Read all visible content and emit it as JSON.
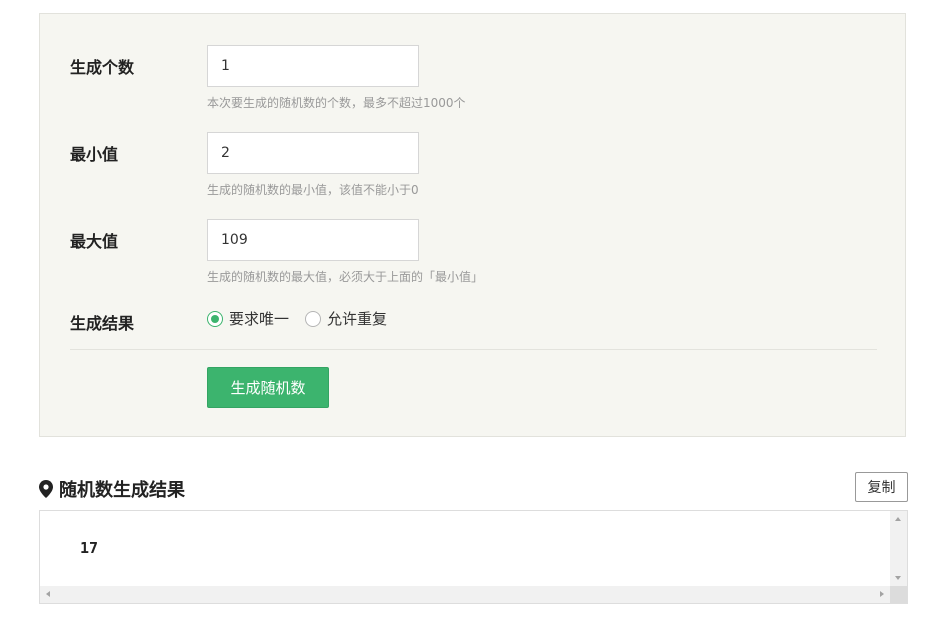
{
  "form": {
    "count": {
      "label": "生成个数",
      "value": "1",
      "hint": "本次要生成的随机数的个数，最多不超过1000个"
    },
    "min": {
      "label": "最小值",
      "value": "2",
      "hint": "生成的随机数的最小值，该值不能小于0"
    },
    "max": {
      "label": "最大值",
      "value": "109",
      "hint": "生成的随机数的最大值，必须大于上面的「最小值」"
    },
    "result_mode": {
      "label": "生成结果",
      "options": [
        {
          "label": "要求唯一",
          "checked": true
        },
        {
          "label": "允许重复",
          "checked": false
        }
      ]
    },
    "generate_label": "生成随机数"
  },
  "result": {
    "title": "随机数生成结果",
    "icon": "map-marker-icon",
    "copy_label": "复制",
    "value": "17"
  },
  "colors": {
    "accent": "#3cb46e",
    "panel_bg": "#f6f6f1"
  }
}
